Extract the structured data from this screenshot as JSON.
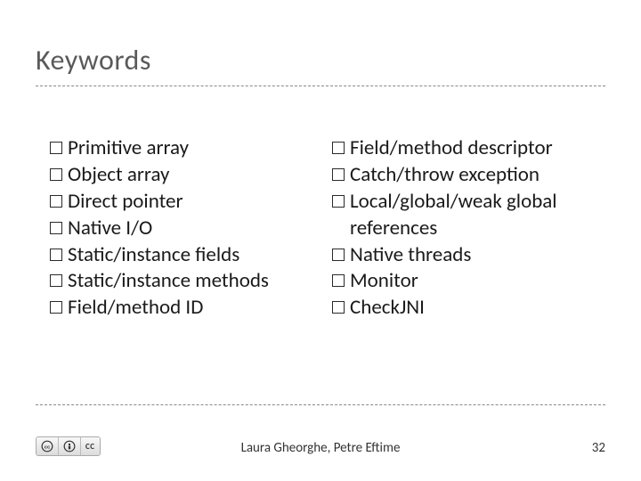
{
  "title": "Keywords",
  "left_items": [
    "Primitive array",
    "Object array",
    "Direct pointer",
    "Native I/O",
    "Static/instance fields",
    "Static/instance methods",
    "Field/method ID"
  ],
  "right_items": [
    "Field/method descriptor",
    "Catch/throw exception",
    "Local/global/weak global references",
    "Native threads",
    "Monitor",
    "CheckJNI"
  ],
  "footer": {
    "license_label": "CC",
    "authors": "Laura Gheorghe, Petre Eftime",
    "page_number": "32"
  }
}
